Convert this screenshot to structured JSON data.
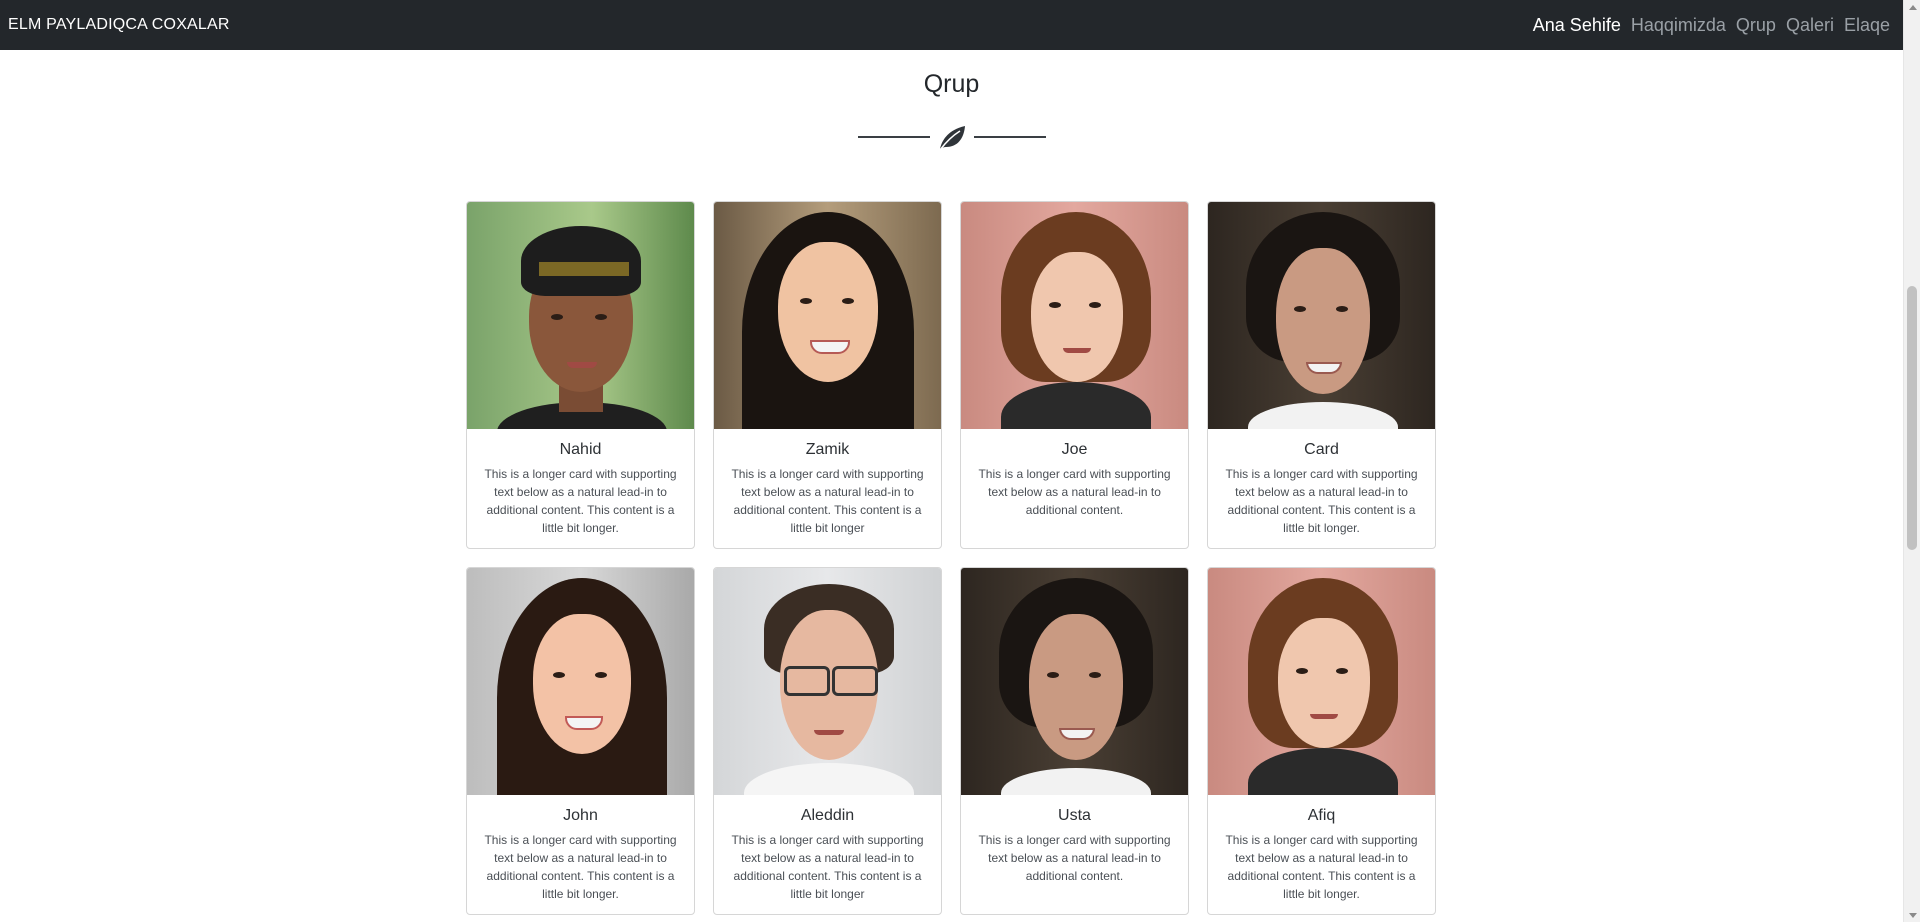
{
  "navbar": {
    "brand": "ELM PAYLADIQCA COXALAR",
    "links": [
      "Ana Sehife",
      "Haqqimizda",
      "Qrup",
      "Qaleri",
      "Elaqe"
    ],
    "active_index": 0
  },
  "section": {
    "title": "Qrup",
    "divider_icon": "leaf-icon"
  },
  "cards": [
    {
      "name": "Nahid",
      "text": "This is a longer card with supporting text below as a natural lead-in to additional content. This content is a little bit longer."
    },
    {
      "name": "Zamik",
      "text": "This is a longer card with supporting text below as a natural lead-in to additional content. This content is a little bit longer"
    },
    {
      "name": "Joe",
      "text": "This is a longer card with supporting text below as a natural lead-in to additional content."
    },
    {
      "name": "Card",
      "text": "This is a longer card with supporting text below as a natural lead-in to additional content. This content is a little bit longer."
    },
    {
      "name": "John",
      "text": "This is a longer card with supporting text below as a natural lead-in to additional content. This content is a little bit longer."
    },
    {
      "name": "Aleddin",
      "text": "This is a longer card with supporting text below as a natural lead-in to additional content. This content is a little bit longer"
    },
    {
      "name": "Usta",
      "text": "This is a longer card with supporting text below as a natural lead-in to additional content."
    },
    {
      "name": "Afiq",
      "text": "This is a longer card with supporting text below as a natural lead-in to additional content. This content is a little bit longer."
    }
  ]
}
